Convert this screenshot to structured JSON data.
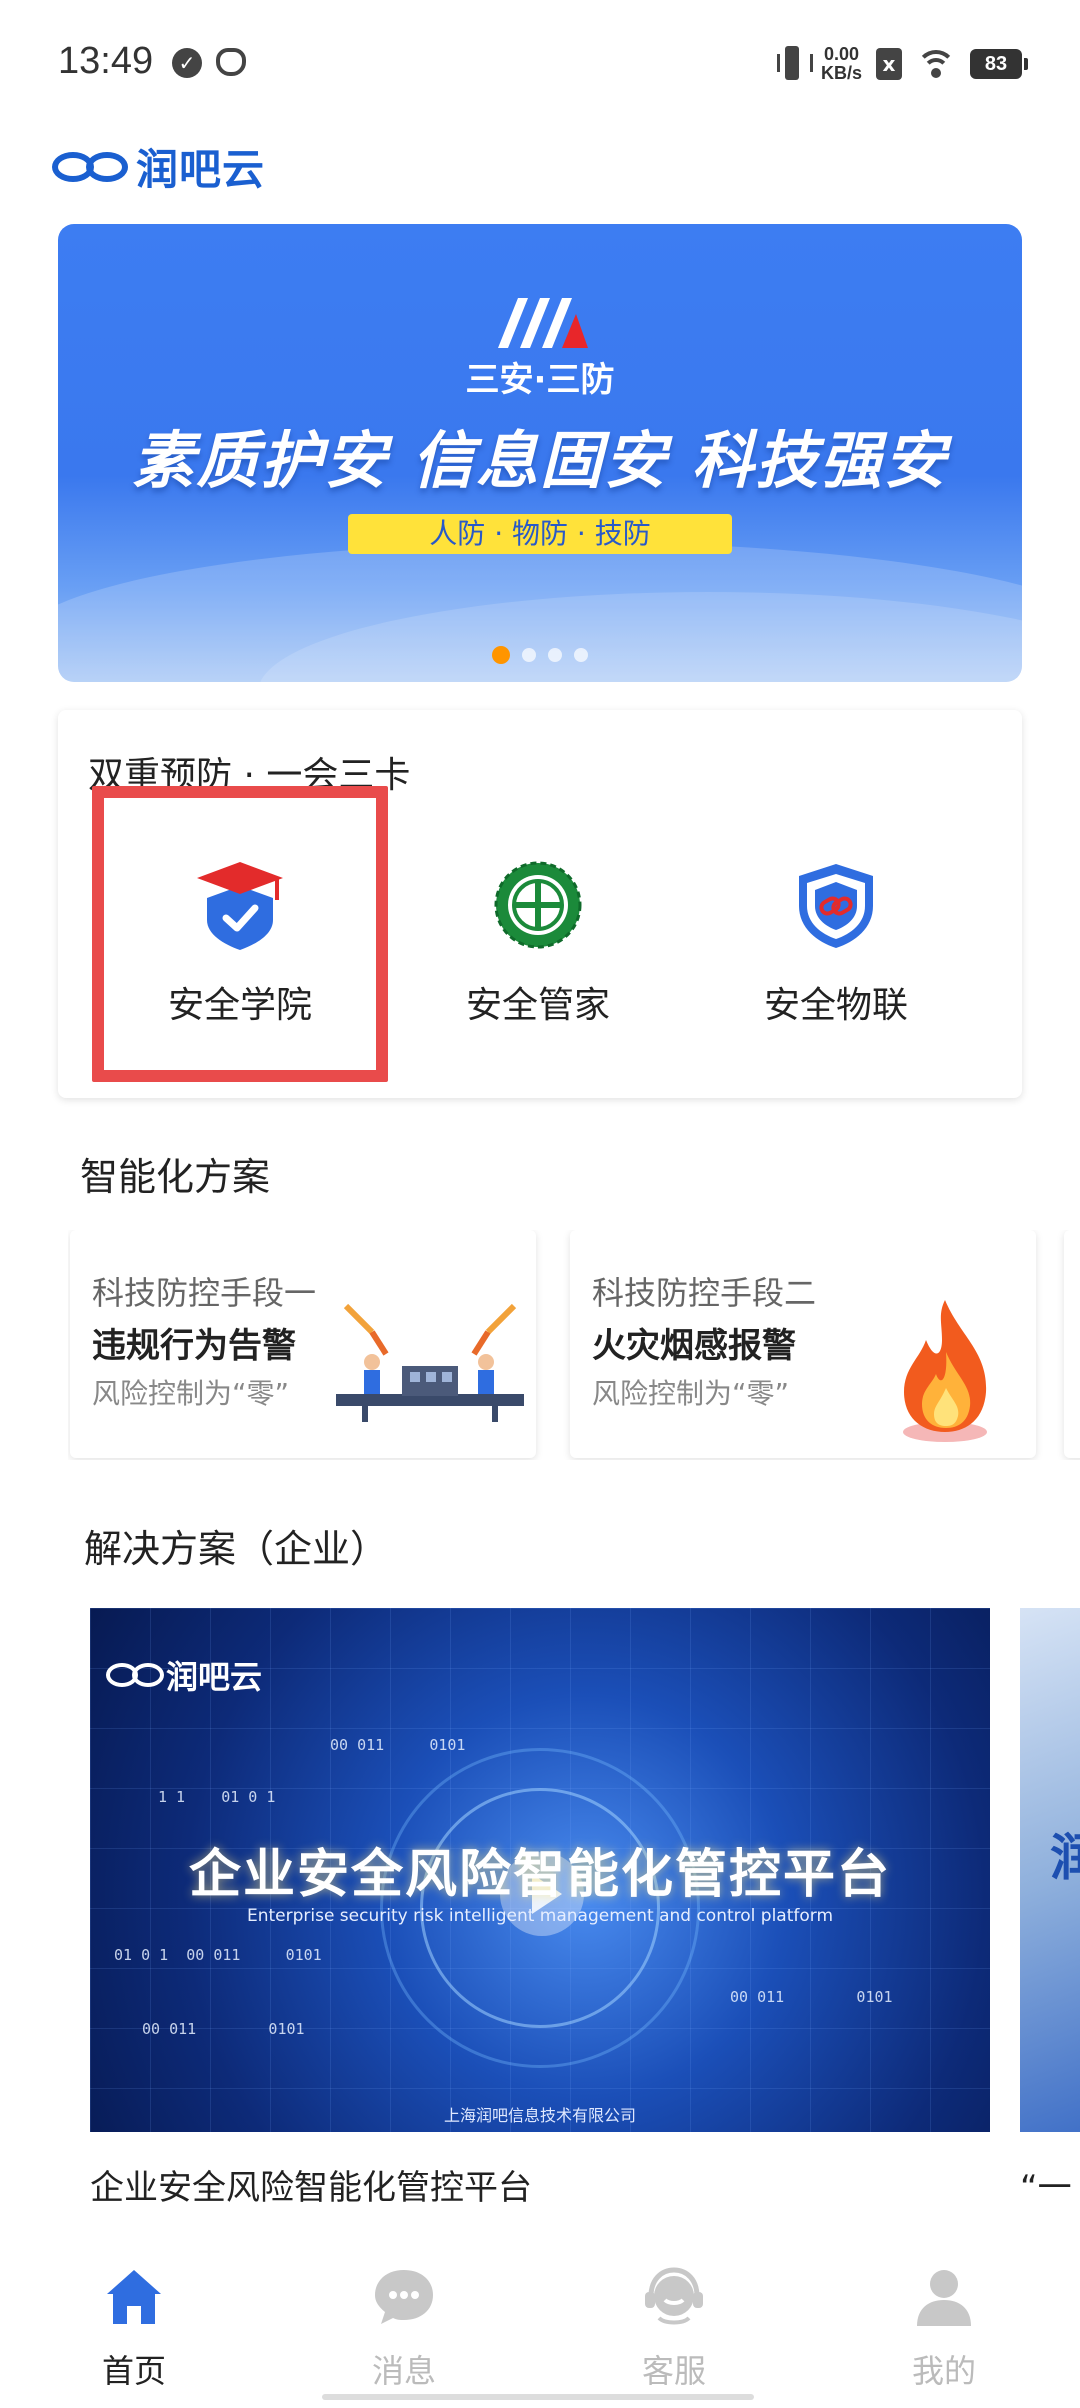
{
  "status_bar": {
    "time": "13:49",
    "net_speed_value": "0.00",
    "net_speed_unit": "KB/s",
    "sim_status": "x",
    "battery": "83",
    "icons": [
      "check-circle-icon",
      "face-icon",
      "vibrate-icon",
      "wifi-icon",
      "battery-icon"
    ]
  },
  "logo": {
    "text": "润吧云"
  },
  "banner": {
    "brand": "三安·三防",
    "slogan": "素质护安  信息固安  科技强安",
    "tags": "人防 · 物防 · 技防",
    "active_dot": 0,
    "dot_count": 4
  },
  "dual_prevention": {
    "title": "双重预防  ·  一会三卡",
    "items": [
      {
        "label": "安全学院",
        "icon": "graduation-shield-icon"
      },
      {
        "label": "安全管家",
        "icon": "safety-emblem-icon"
      },
      {
        "label": "安全物联",
        "icon": "link-shield-icon"
      }
    ]
  },
  "smart_solutions": {
    "title": "智能化方案",
    "items": [
      {
        "subtitle": "科技防控手段一",
        "title": "违规行为告警",
        "note": "风险控制为“零”",
        "icon": "robot-arm-factory-icon"
      },
      {
        "subtitle": "科技防控手段二",
        "title": "火灾烟感报警",
        "note": "风险控制为“零”",
        "icon": "fire-icon"
      }
    ]
  },
  "enterprise_solutions": {
    "title": "解决方案（企业）",
    "items": [
      {
        "logo": "润吧云",
        "video_title": "企业安全风险智能化管控平台",
        "video_subtitle": "Enterprise security risk intelligent management and control platform",
        "company": "上海润吧信息技术有限公司",
        "caption": "企业安全风险智能化管控平台"
      },
      {
        "partial_text": "润",
        "caption": "“一"
      }
    ]
  },
  "tabbar": {
    "items": [
      {
        "label": "首页",
        "icon": "home-icon",
        "active": true
      },
      {
        "label": "消息",
        "icon": "message-icon",
        "active": false
      },
      {
        "label": "客服",
        "icon": "customer-service-icon",
        "active": false
      },
      {
        "label": "我的",
        "icon": "user-icon",
        "active": false
      }
    ]
  },
  "colors": {
    "brand_blue": "#1a5fd0",
    "banner_blue": "#3d7df2",
    "highlight_red": "#e94b4b",
    "dot_active": "#ff9500",
    "tab_inactive": "#bbbbbb"
  }
}
